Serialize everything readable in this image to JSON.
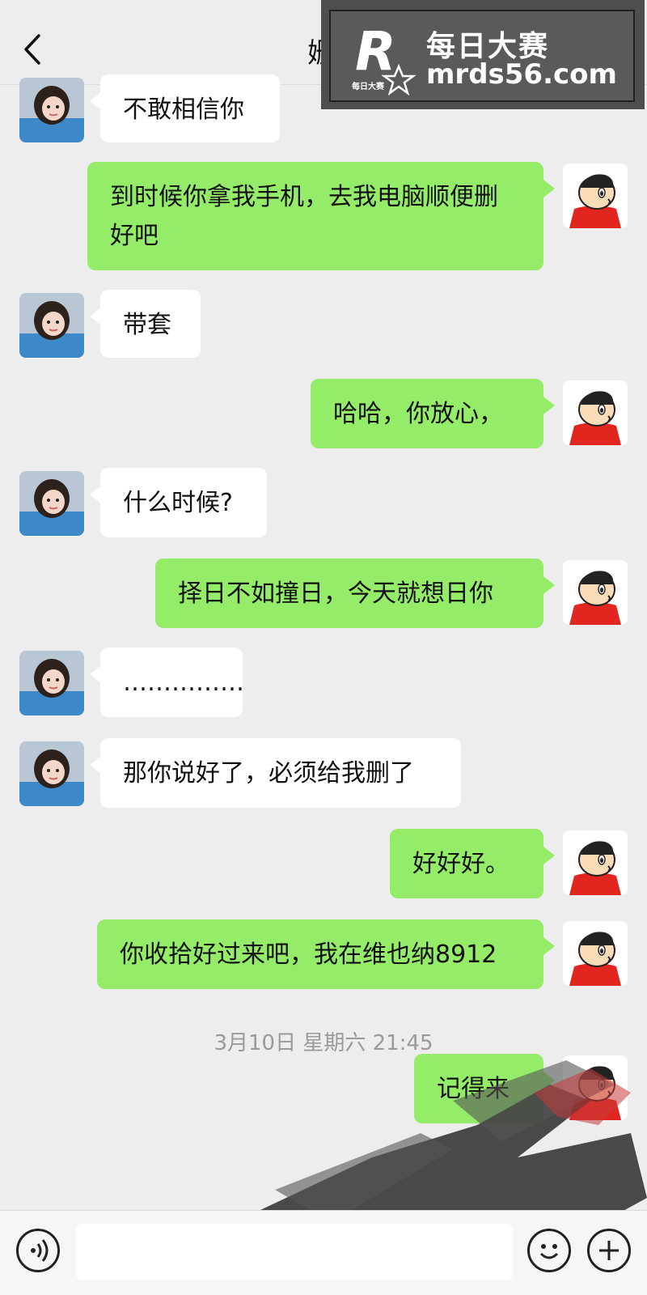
{
  "header": {
    "back_icon": "chevron-left-icon",
    "contact_name": "姗",
    "more_label": "···"
  },
  "watermark": {
    "logo_letter": "R",
    "logo_small": "每日大赛",
    "title": "每日大赛",
    "url": "mrds56.com"
  },
  "messages": [
    {
      "side": "left",
      "text": "不敢相信你"
    },
    {
      "side": "right",
      "text": "到时候你拿我手机，去我电脑顺便删好吧"
    },
    {
      "side": "left",
      "text": "带套"
    },
    {
      "side": "right",
      "text": "哈哈，你放心，"
    },
    {
      "side": "left",
      "text": "什么时候?"
    },
    {
      "side": "right",
      "text": "择日不如撞日，今天就想日你"
    },
    {
      "side": "left",
      "text": "……………"
    },
    {
      "side": "left",
      "text": "那你说好了，必须给我删了"
    },
    {
      "side": "right",
      "text": "好好好。"
    },
    {
      "side": "right",
      "text": "你收拾好过来吧，我在维也纳8912"
    },
    {
      "side": "right",
      "text": "记得来"
    }
  ],
  "timestamp": "3月10日 星期六 21:45",
  "input": {
    "value": "",
    "placeholder": ""
  },
  "colors": {
    "self_bubble": "#95ec69",
    "other_bubble": "#ffffff",
    "background": "#ededed"
  }
}
